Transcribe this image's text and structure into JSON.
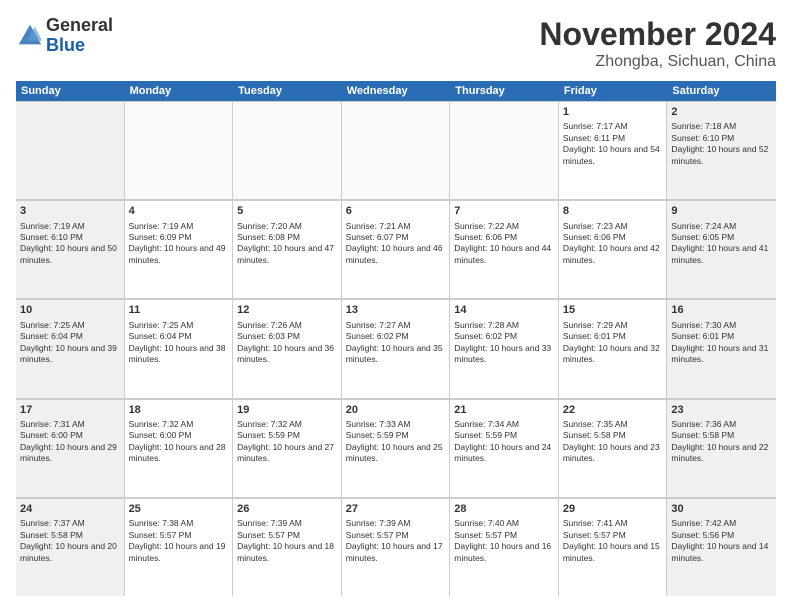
{
  "header": {
    "logo": {
      "line1": "General",
      "line2": "Blue"
    },
    "month": "November 2024",
    "location": "Zhongba, Sichuan, China"
  },
  "days_of_week": [
    "Sunday",
    "Monday",
    "Tuesday",
    "Wednesday",
    "Thursday",
    "Friday",
    "Saturday"
  ],
  "weeks": [
    [
      {
        "day": "",
        "empty": true
      },
      {
        "day": "",
        "empty": true
      },
      {
        "day": "",
        "empty": true
      },
      {
        "day": "",
        "empty": true
      },
      {
        "day": "",
        "empty": true
      },
      {
        "day": "1",
        "sunrise": "Sunrise: 7:17 AM",
        "sunset": "Sunset: 6:11 PM",
        "daylight": "Daylight: 10 hours and 54 minutes."
      },
      {
        "day": "2",
        "sunrise": "Sunrise: 7:18 AM",
        "sunset": "Sunset: 6:10 PM",
        "daylight": "Daylight: 10 hours and 52 minutes."
      }
    ],
    [
      {
        "day": "3",
        "sunrise": "Sunrise: 7:19 AM",
        "sunset": "Sunset: 6:10 PM",
        "daylight": "Daylight: 10 hours and 50 minutes."
      },
      {
        "day": "4",
        "sunrise": "Sunrise: 7:19 AM",
        "sunset": "Sunset: 6:09 PM",
        "daylight": "Daylight: 10 hours and 49 minutes."
      },
      {
        "day": "5",
        "sunrise": "Sunrise: 7:20 AM",
        "sunset": "Sunset: 6:08 PM",
        "daylight": "Daylight: 10 hours and 47 minutes."
      },
      {
        "day": "6",
        "sunrise": "Sunrise: 7:21 AM",
        "sunset": "Sunset: 6:07 PM",
        "daylight": "Daylight: 10 hours and 46 minutes."
      },
      {
        "day": "7",
        "sunrise": "Sunrise: 7:22 AM",
        "sunset": "Sunset: 6:06 PM",
        "daylight": "Daylight: 10 hours and 44 minutes."
      },
      {
        "day": "8",
        "sunrise": "Sunrise: 7:23 AM",
        "sunset": "Sunset: 6:06 PM",
        "daylight": "Daylight: 10 hours and 42 minutes."
      },
      {
        "day": "9",
        "sunrise": "Sunrise: 7:24 AM",
        "sunset": "Sunset: 6:05 PM",
        "daylight": "Daylight: 10 hours and 41 minutes."
      }
    ],
    [
      {
        "day": "10",
        "sunrise": "Sunrise: 7:25 AM",
        "sunset": "Sunset: 6:04 PM",
        "daylight": "Daylight: 10 hours and 39 minutes."
      },
      {
        "day": "11",
        "sunrise": "Sunrise: 7:25 AM",
        "sunset": "Sunset: 6:04 PM",
        "daylight": "Daylight: 10 hours and 38 minutes."
      },
      {
        "day": "12",
        "sunrise": "Sunrise: 7:26 AM",
        "sunset": "Sunset: 6:03 PM",
        "daylight": "Daylight: 10 hours and 36 minutes."
      },
      {
        "day": "13",
        "sunrise": "Sunrise: 7:27 AM",
        "sunset": "Sunset: 6:02 PM",
        "daylight": "Daylight: 10 hours and 35 minutes."
      },
      {
        "day": "14",
        "sunrise": "Sunrise: 7:28 AM",
        "sunset": "Sunset: 6:02 PM",
        "daylight": "Daylight: 10 hours and 33 minutes."
      },
      {
        "day": "15",
        "sunrise": "Sunrise: 7:29 AM",
        "sunset": "Sunset: 6:01 PM",
        "daylight": "Daylight: 10 hours and 32 minutes."
      },
      {
        "day": "16",
        "sunrise": "Sunrise: 7:30 AM",
        "sunset": "Sunset: 6:01 PM",
        "daylight": "Daylight: 10 hours and 31 minutes."
      }
    ],
    [
      {
        "day": "17",
        "sunrise": "Sunrise: 7:31 AM",
        "sunset": "Sunset: 6:00 PM",
        "daylight": "Daylight: 10 hours and 29 minutes."
      },
      {
        "day": "18",
        "sunrise": "Sunrise: 7:32 AM",
        "sunset": "Sunset: 6:00 PM",
        "daylight": "Daylight: 10 hours and 28 minutes."
      },
      {
        "day": "19",
        "sunrise": "Sunrise: 7:32 AM",
        "sunset": "Sunset: 5:59 PM",
        "daylight": "Daylight: 10 hours and 27 minutes."
      },
      {
        "day": "20",
        "sunrise": "Sunrise: 7:33 AM",
        "sunset": "Sunset: 5:59 PM",
        "daylight": "Daylight: 10 hours and 25 minutes."
      },
      {
        "day": "21",
        "sunrise": "Sunrise: 7:34 AM",
        "sunset": "Sunset: 5:59 PM",
        "daylight": "Daylight: 10 hours and 24 minutes."
      },
      {
        "day": "22",
        "sunrise": "Sunrise: 7:35 AM",
        "sunset": "Sunset: 5:58 PM",
        "daylight": "Daylight: 10 hours and 23 minutes."
      },
      {
        "day": "23",
        "sunrise": "Sunrise: 7:36 AM",
        "sunset": "Sunset: 5:58 PM",
        "daylight": "Daylight: 10 hours and 22 minutes."
      }
    ],
    [
      {
        "day": "24",
        "sunrise": "Sunrise: 7:37 AM",
        "sunset": "Sunset: 5:58 PM",
        "daylight": "Daylight: 10 hours and 20 minutes."
      },
      {
        "day": "25",
        "sunrise": "Sunrise: 7:38 AM",
        "sunset": "Sunset: 5:57 PM",
        "daylight": "Daylight: 10 hours and 19 minutes."
      },
      {
        "day": "26",
        "sunrise": "Sunrise: 7:39 AM",
        "sunset": "Sunset: 5:57 PM",
        "daylight": "Daylight: 10 hours and 18 minutes."
      },
      {
        "day": "27",
        "sunrise": "Sunrise: 7:39 AM",
        "sunset": "Sunset: 5:57 PM",
        "daylight": "Daylight: 10 hours and 17 minutes."
      },
      {
        "day": "28",
        "sunrise": "Sunrise: 7:40 AM",
        "sunset": "Sunset: 5:57 PM",
        "daylight": "Daylight: 10 hours and 16 minutes."
      },
      {
        "day": "29",
        "sunrise": "Sunrise: 7:41 AM",
        "sunset": "Sunset: 5:57 PM",
        "daylight": "Daylight: 10 hours and 15 minutes."
      },
      {
        "day": "30",
        "sunrise": "Sunrise: 7:42 AM",
        "sunset": "Sunset: 5:56 PM",
        "daylight": "Daylight: 10 hours and 14 minutes."
      }
    ]
  ]
}
